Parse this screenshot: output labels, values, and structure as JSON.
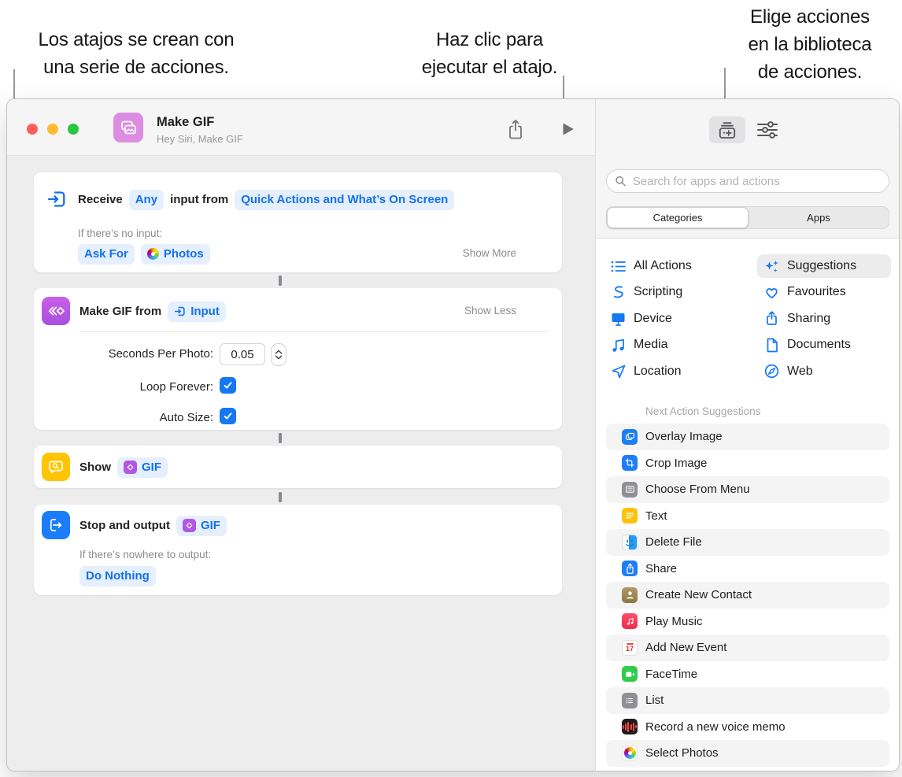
{
  "callouts": {
    "create": {
      "line1": "Los atajos se crean con",
      "line2": "una serie de acciones."
    },
    "run": {
      "line1": "Haz clic para",
      "line2": "ejecutar el atajo."
    },
    "library": {
      "line1": "Elige acciones",
      "line2": "en la biblioteca",
      "line3": "de acciones."
    }
  },
  "titlebar": {
    "title": "Make GIF",
    "subtitle": "Hey Siri, Make GIF"
  },
  "shortcut": {
    "receive": {
      "verb": "Receive",
      "any_pill": "Any",
      "middle": "input from",
      "source_pill": "Quick Actions and What’s On Screen",
      "condition": "If there’s no input:",
      "ask_for_pill": "Ask For",
      "photos_pill": "Photos",
      "show_more": "Show More"
    },
    "make_gif": {
      "title": "Make GIF from",
      "input_pill": "Input",
      "show_less": "Show Less",
      "seconds_label": "Seconds Per Photo:",
      "seconds_value": "0.05",
      "loop_label": "Loop Forever:",
      "auto_size_label": "Auto Size:"
    },
    "show": {
      "title": "Show",
      "gif_pill": "GIF"
    },
    "stop": {
      "title": "Stop and output",
      "gif_pill": "GIF",
      "condition": "If there’s nowhere to output:",
      "do_nothing_pill": "Do Nothing"
    }
  },
  "sidebar": {
    "search_placeholder": "Search for apps and actions",
    "tabs": [
      {
        "label": "Categories"
      },
      {
        "label": "Apps"
      }
    ],
    "categories_left": [
      {
        "label": "All Actions"
      },
      {
        "label": "Scripting"
      },
      {
        "label": "Device"
      },
      {
        "label": "Media"
      },
      {
        "label": "Location"
      }
    ],
    "categories_right": [
      {
        "label": "Suggestions"
      },
      {
        "label": "Favourites"
      },
      {
        "label": "Sharing"
      },
      {
        "label": "Documents"
      },
      {
        "label": "Web"
      }
    ],
    "suggestions_header": "Next Action Suggestions",
    "suggestions": [
      {
        "label": "Overlay Image"
      },
      {
        "label": "Crop Image"
      },
      {
        "label": "Choose From Menu"
      },
      {
        "label": "Text"
      },
      {
        "label": "Delete File"
      },
      {
        "label": "Share"
      },
      {
        "label": "Create New Contact"
      },
      {
        "label": "Play Music"
      },
      {
        "label": "Add New Event",
        "day": "17"
      },
      {
        "label": "FaceTime"
      },
      {
        "label": "List"
      },
      {
        "label": "Record a new voice memo"
      },
      {
        "label": "Select Photos"
      }
    ]
  },
  "colors": {
    "accent_blue": "#1271EE",
    "pill_bg": "#E5EFFD",
    "gif_purple": "#B257E4",
    "show_yellow": "#FFC502",
    "output_blue": "#1B7DFB",
    "traffic_red": "#FF5F57",
    "traffic_yellow": "#FEBC2E",
    "traffic_green": "#28C840"
  }
}
